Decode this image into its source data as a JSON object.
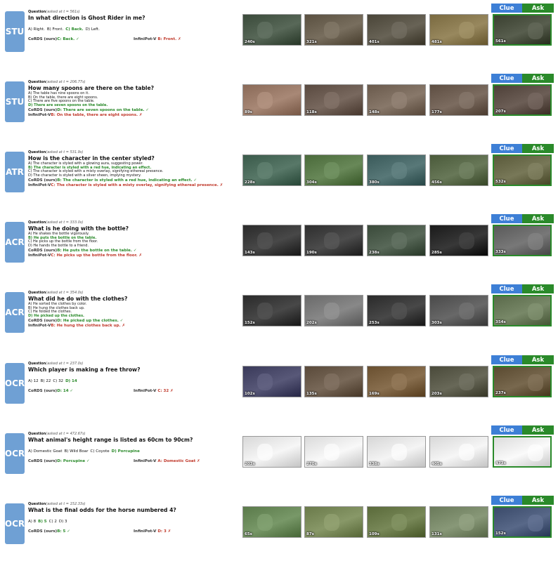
{
  "clue_label": "Clue",
  "ask_label": "Ask",
  "question_label": "Question",
  "ours_label": "CoRDS (ours)",
  "baseline_label": "InfiniPot-V",
  "check_mark": "✓",
  "cross_mark": "✗",
  "rows": [
    {
      "badge": "STU",
      "asked": "(asked at t = 561s)",
      "question": "In what direction is Ghost Rider in me?",
      "options": [
        "A) Right.",
        "B) Front.",
        "C) Back.",
        "D) Left."
      ],
      "correct_index": 2,
      "ours_answer": "C: Back.",
      "baseline_answer": "B: Front.",
      "times": [
        "240s",
        "321s",
        "401s",
        "481s",
        "561s"
      ],
      "colors": [
        "#3a4a3a",
        "#5a5040",
        "#4a4538",
        "#7a6a40",
        "#3a4030"
      ]
    },
    {
      "badge": "STU",
      "asked": "(asked at t = 206.77s)",
      "question": "How many spoons are there on the table?",
      "options": [
        "A) The table has nine spoons on it.",
        "B) On the table, there are eight spoons.",
        "C) There are five spoons on the table.",
        "D) There are seven spoons on the table."
      ],
      "correct_index": 3,
      "ours_answer": "D: There are seven spoons on the table.",
      "baseline_answer": "B: On the table, there are eight spoons.",
      "times": [
        "89s",
        "118s",
        "148s",
        "177s",
        "207s"
      ],
      "colors": [
        "#8a6a58",
        "#5a4a40",
        "#6a5a4c",
        "#5e4e42",
        "#4e4038"
      ]
    },
    {
      "badge": "ATR",
      "asked": "(asked at t = 531.9s)",
      "question": "How is the character in the center styled?",
      "options": [
        "A) The character is styled with a glowing aura, suggesting power.",
        "B) The character is styled with a red hue, indicating an effect.",
        "C) The character is styled with a misty overlay, signifying ethereal presence.",
        "D) The character is styled with a silver sheen, implying mystery."
      ],
      "correct_index": 1,
      "ours_answer": "B: The character is styled with a red hue, indicating an effect.",
      "baseline_answer": "C: The character is styled with a misty overlay, signifying ethereal presence.",
      "times": [
        "228s",
        "304s",
        "380s",
        "456s",
        "532s"
      ],
      "colors": [
        "#3a5a4a",
        "#4a6a3a",
        "#3a5a5a",
        "#4a5a3a",
        "#5a5a3a"
      ]
    },
    {
      "badge": "ACR",
      "asked": "(asked at t = 333.0s)",
      "question": "What is he doing with the bottle?",
      "options": [
        "A) He shakes the bottle vigorously.",
        "B) He puts the bottle on the table.",
        "C) He picks up the bottle from the floor.",
        "D) He hands the bottle to a friend."
      ],
      "correct_index": 1,
      "ours_answer": "B: He puts the bottle on the table.",
      "baseline_answer": "C: He picks up the bottle from the floor.",
      "times": [
        "143s",
        "190s",
        "238s",
        "285s",
        "333s"
      ],
      "colors": [
        "#2a2a2a",
        "#2e2e2e",
        "#3a4a3a",
        "#1a1a1a",
        "#5a5a5a"
      ]
    },
    {
      "badge": "ACR",
      "asked": "(asked at t = 354.0s)",
      "question": "What did he do with the clothes?",
      "options": [
        "A) He sorted the clothes by color.",
        "B) He hung the clothes back up.",
        "C) He folded the clothes.",
        "D) He picked up the clothes."
      ],
      "correct_index": 3,
      "ours_answer": "D: He picked up the clothes.",
      "baseline_answer": "B: He hung the clothes back up.",
      "times": [
        "152s",
        "202s",
        "253s",
        "303s",
        "354s"
      ],
      "colors": [
        "#2a2a2a",
        "#6a6a6a",
        "#2a2a2a",
        "#4a4a4a",
        "#5a6a4a"
      ]
    },
    {
      "badge": "OCR",
      "asked": "(asked at t = 237.0s)",
      "question": "Which player is making a free throw?",
      "options": [
        "A) 12",
        "B) 22",
        "C) 32",
        "D) 14"
      ],
      "correct_index": 3,
      "ours_answer": "D: 14",
      "baseline_answer": "C: 32",
      "times": [
        "102s",
        "135s",
        "169s",
        "203s",
        "237s"
      ],
      "colors": [
        "#3a3a5a",
        "#5a4a3a",
        "#6a5030",
        "#4a4a3a",
        "#5a4a30"
      ]
    },
    {
      "badge": "OCR",
      "asked": "(asked at t = 472.67s)",
      "question": "What animal's height range is listed as 60cm to 90cm?",
      "options": [
        "A) Domestic Goat",
        "B) Wild Boar",
        "C) Coyote",
        "D) Porcupine"
      ],
      "correct_index": 3,
      "ours_answer": "D: Porcupine",
      "baseline_answer": "A: Domestic Goat",
      "times": [
        "203s",
        "270s",
        "338s",
        "405s",
        "473s"
      ],
      "colors": [
        "#d8d8d8",
        "#dadada",
        "#d6d6d6",
        "#d8d8d8",
        "#dcdcdc"
      ]
    },
    {
      "badge": "OCR",
      "asked": "(asked at t = 152.33s)",
      "question": "What is the final odds for the horse numbered 4?",
      "options": [
        "A) 8",
        "B) 5",
        "C) 2",
        "D) 3"
      ],
      "correct_index": 1,
      "ours_answer": "B: 5",
      "baseline_answer": "D: 3",
      "times": [
        "65s",
        "87s",
        "109s",
        "131s",
        "152s"
      ],
      "colors": [
        "#5a7a4a",
        "#6a7a4a",
        "#5a6a3a",
        "#6a7a5a",
        "#3a4a6a"
      ]
    }
  ]
}
